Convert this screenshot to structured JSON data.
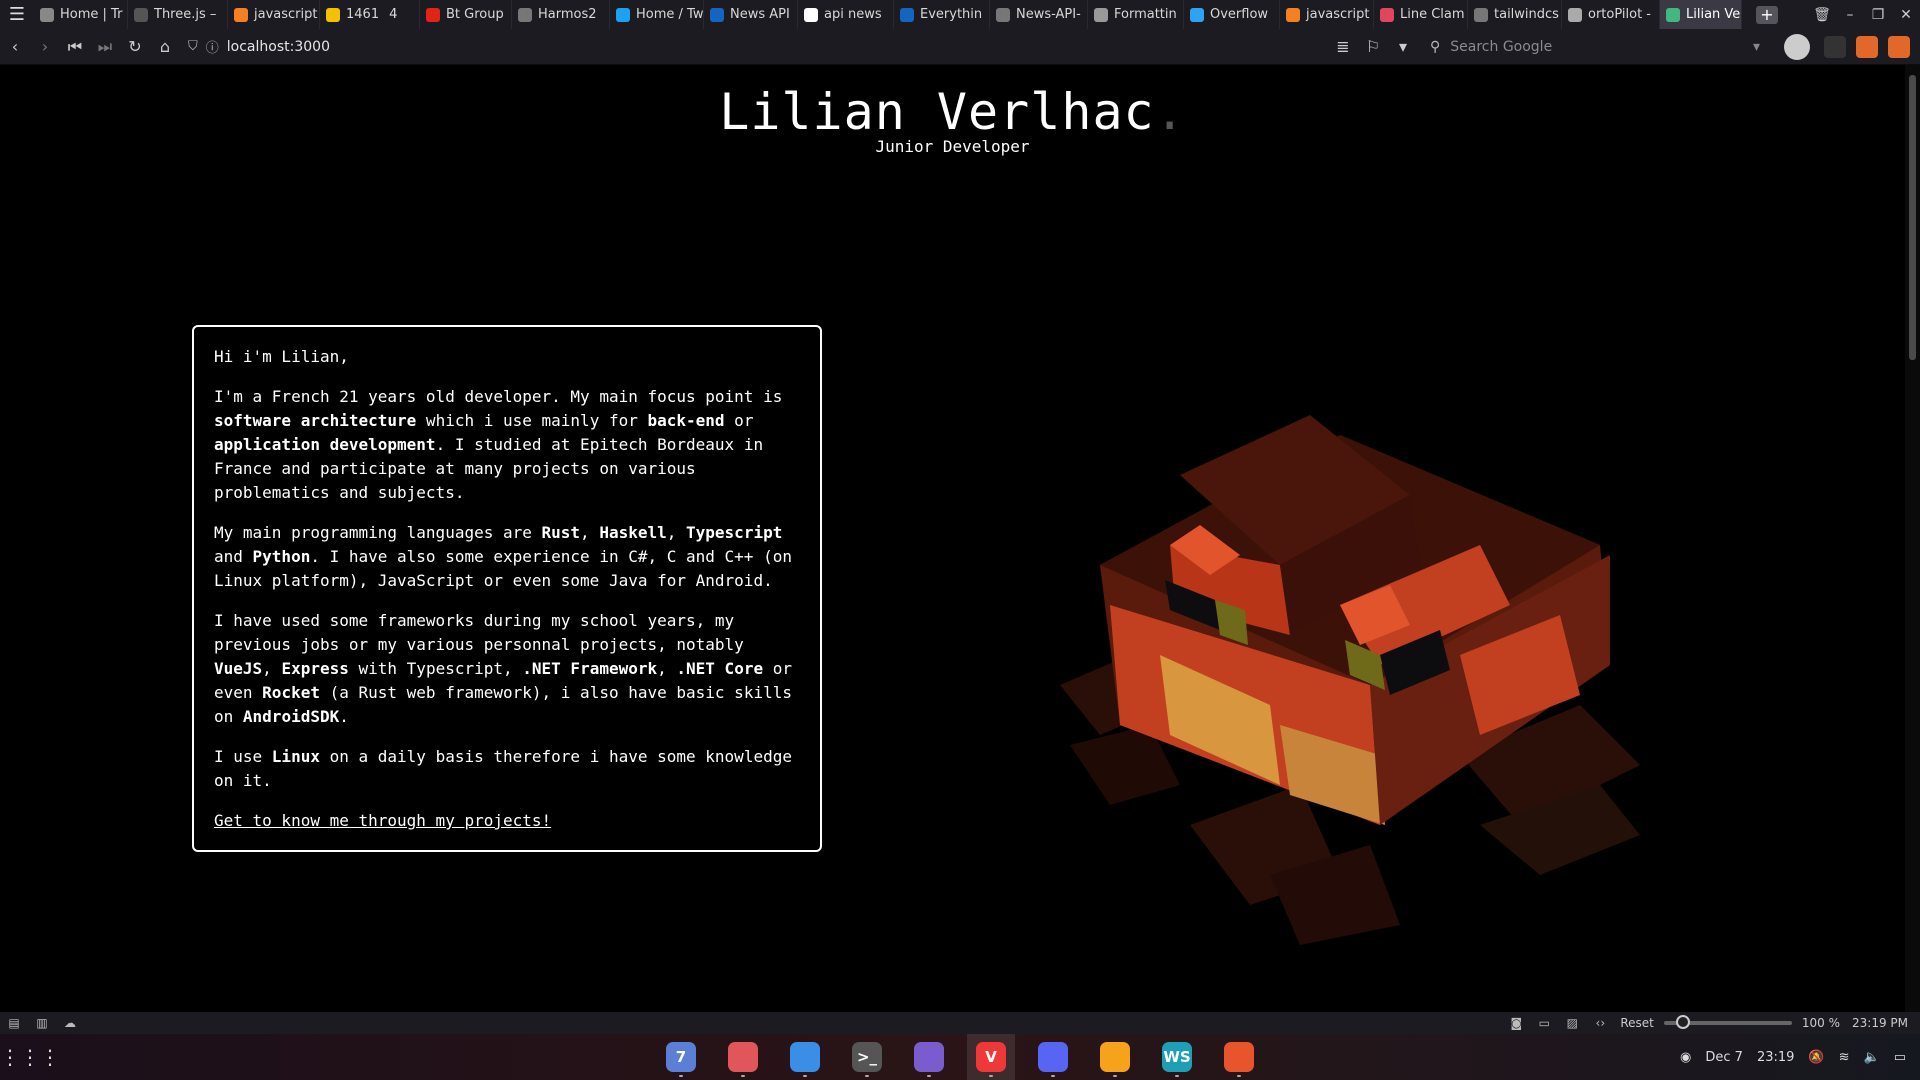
{
  "browser": {
    "tabs": [
      {
        "label": "Home | Tr",
        "icon": "globe-icon",
        "color": "#888"
      },
      {
        "label": "Three.js –",
        "icon": "threejs-icon",
        "color": "#555"
      },
      {
        "label": "javascript",
        "icon": "stackoverflow-icon",
        "color": "#f48024"
      },
      {
        "label": "1461",
        "icon": "plus-icon",
        "color": "#f2c200",
        "counter": "4"
      },
      {
        "label": "Bt Group",
        "icon": "btgroup-icon",
        "color": "#e2231a"
      },
      {
        "label": "Harmos2",
        "icon": "github-icon",
        "color": "#777"
      },
      {
        "label": "Home / Tw",
        "icon": "twitter-icon",
        "color": "#1da1f2"
      },
      {
        "label": "News API",
        "icon": "newsapi-icon",
        "color": "#1565c0"
      },
      {
        "label": "api news",
        "icon": "google-icon",
        "color": "#fff"
      },
      {
        "label": "Everythin",
        "icon": "newsapi-icon",
        "color": "#1565c0"
      },
      {
        "label": "News-API-",
        "icon": "github-icon",
        "color": "#777"
      },
      {
        "label": "Formattin",
        "icon": "document-icon",
        "color": "#999"
      },
      {
        "label": "Overflow",
        "icon": "overflow-icon",
        "color": "#2ea3f2"
      },
      {
        "label": "javascript",
        "icon": "stackoverflow-icon",
        "color": "#f48024"
      },
      {
        "label": "Line Clam",
        "icon": "asterisk-icon",
        "color": "#e0475f"
      },
      {
        "label": "tailwindcs",
        "icon": "github-icon",
        "color": "#777"
      },
      {
        "label": "ortoPilot -",
        "icon": "speaker-icon",
        "color": "#aaa"
      },
      {
        "label": "Lilian Verl",
        "icon": "vite-icon",
        "color": "#41b883",
        "active": true
      }
    ],
    "url": "localhost:3000",
    "search_placeholder": "Search Google",
    "new_tab_label": "+"
  },
  "page": {
    "title": "Lilian Verlhac",
    "title_dot": ".",
    "subtitle": "Junior Developer",
    "about": {
      "greeting": "Hi i'm Lilian,",
      "p1_a": "I'm a French 21 years old developer. My main focus point is ",
      "p1_b": "software architecture",
      "p1_c": " which i use mainly for ",
      "p1_d": "back-end",
      "p1_e": " or ",
      "p1_f": "application development",
      "p1_g": ". I studied at Epitech Bordeaux in France and participate at many projects on various problematics and subjects.",
      "p2_a": "My main programming languages are ",
      "p2_b": "Rust",
      "p2_c": ", ",
      "p2_d": "Haskell",
      "p2_e": ", ",
      "p2_f": "Typescript",
      "p2_g": " and ",
      "p2_h": "Python",
      "p2_i": ". I have also some experience in C#, C and C++ (on Linux platform), JavaScript or even some Java for Android.",
      "p3_a": "I have used some frameworks during my school years, my previous jobs or my various personnal projects, notably ",
      "p3_b": "VueJS",
      "p3_c": ", ",
      "p3_d": "Express",
      "p3_e": " with Typescript, ",
      "p3_f": ".NET Framework",
      "p3_g": ", ",
      "p3_h": ".NET Core",
      "p3_i": " or even ",
      "p3_j": "Rocket",
      "p3_k": " (a Rust web framework), i also have basic skills on ",
      "p3_l": "AndroidSDK",
      "p3_m": ".",
      "p4_a": "I use ",
      "p4_b": "Linux",
      "p4_c": " on a daily basis therefore i have some knowledge on it.",
      "link": "Get to know me through my projects!"
    }
  },
  "statusbar": {
    "reset_label": "Reset",
    "zoom": "100 %",
    "zoom_level": 0.15,
    "time": "23:19 PM"
  },
  "taskbar": {
    "apps": [
      {
        "name": "calendar-app",
        "label": "7",
        "color": "#5b7fd6"
      },
      {
        "name": "photos-app",
        "label": "",
        "color": "#e0565b"
      },
      {
        "name": "files-app",
        "label": "",
        "color": "#3a8ee6"
      },
      {
        "name": "terminal-app",
        "label": ">_",
        "color": "#555"
      },
      {
        "name": "obsidian-app",
        "label": "",
        "color": "#7b5ccf"
      },
      {
        "name": "vivaldi-app",
        "label": "V",
        "color": "#ef3939",
        "active": true
      },
      {
        "name": "discord-app",
        "label": "",
        "color": "#5865f2"
      },
      {
        "name": "postman-app",
        "label": "",
        "color": "#f7a21b"
      },
      {
        "name": "webstorm-app",
        "label": "WS",
        "color": "#1f9fb6"
      },
      {
        "name": "firefox-app",
        "label": "",
        "color": "#e8542c"
      }
    ],
    "date": "Dec 7",
    "time": "23:19"
  }
}
